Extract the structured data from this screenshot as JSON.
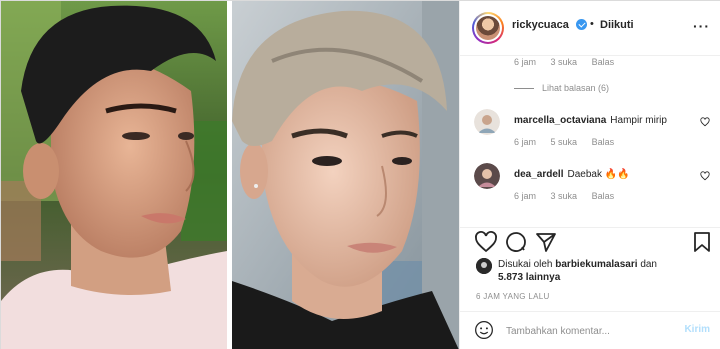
{
  "header": {
    "username": "rickycuaca",
    "separator": "•",
    "follow_status": "Diikuti",
    "more_icon": "more-horizontal-icon"
  },
  "comments": {
    "first_meta": {
      "time": "6 jam",
      "likes": "3 suka",
      "reply": "Balas"
    },
    "view_replies": "Lihat balasan (6)",
    "items": [
      {
        "username": "marcella_octaviana",
        "text": "Hampir mirip",
        "time": "6 jam",
        "likes": "5 suka",
        "reply": "Balas"
      },
      {
        "username": "dea_ardell",
        "text": "Daebak 🔥🔥",
        "time": "6 jam",
        "likes": "3 suka",
        "reply": "Balas"
      }
    ]
  },
  "actions": {
    "icons": [
      "heart-icon",
      "comment-icon",
      "share-icon",
      "bookmark-icon"
    ],
    "likes_prefix": "Disukai oleh",
    "likes_user": "barbiekumalasari",
    "likes_mid": "dan",
    "likes_count": "5.873 lainnya",
    "timeago": "6 JAM YANG LALU"
  },
  "add_comment": {
    "placeholder": "Tambahkan komentar...",
    "post_label": "Kirim"
  },
  "colors": {
    "verified": "#3897f0",
    "post_button": "#b2dffc",
    "muted_text": "#8e8e8e"
  }
}
